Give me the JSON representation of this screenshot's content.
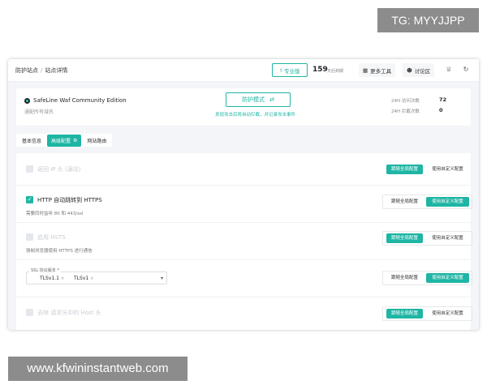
{
  "watermarks": {
    "top": "TG: MYYJJPP",
    "bottom": "www.kfwininstantweb.com"
  },
  "topbar": {
    "breadcrumb": [
      "防护站点",
      "站点详情"
    ],
    "pro_label": "专业版",
    "days_value": "159",
    "days_label": "天后到期",
    "more_tools": "更多工具",
    "discuss": "讨论区"
  },
  "site": {
    "title": "SafeLine Waf Community Edition",
    "subtitle": "通配所有域名",
    "mode_label": "防护模式",
    "mode_hint": "发现攻击后将自动拦截，并记录攻击事件",
    "stats": [
      {
        "label": "24H 访问次数",
        "value": "72"
      },
      {
        "label": "24H 拦截次数",
        "value": "0"
      }
    ]
  },
  "tabs": [
    "基本信息",
    "高级配置",
    "网站路由"
  ],
  "settings": {
    "follow_global": "跟随全局配置",
    "use_custom": "使用自定义配置",
    "rows": [
      {
        "title": "返回 IP 头 (源站)",
        "desc": ""
      },
      {
        "title": "HTTP 自动跳转到 HTTPS",
        "desc": "需要同时监听 80 和 443/ssl"
      },
      {
        "title": "启用 HSTS",
        "desc": "强制浏览器使用 HTTPS 进行通信"
      },
      {
        "title": "",
        "desc": ""
      },
      {
        "title": "去除 请求头中的 Host 头",
        "desc": ""
      }
    ],
    "ssl_label": "SSL 协议版本 *",
    "ssl_options": [
      "TLSv1.1",
      "TLSv1"
    ]
  },
  "colors": {
    "accent": "#1fb5a4"
  }
}
